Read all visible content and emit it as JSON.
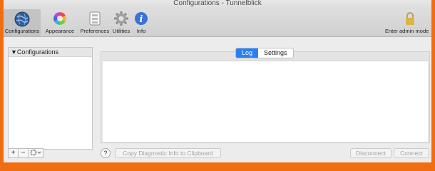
{
  "window": {
    "title": "Configurations - Tunnelblick"
  },
  "toolbar": {
    "items": [
      {
        "label": "Configurations",
        "icon": "globe-icon"
      },
      {
        "label": "Appearance",
        "icon": "color-wheel-icon"
      },
      {
        "label": "Preferences",
        "icon": "switch-icon"
      },
      {
        "label": "Utilities",
        "icon": "gear-icon"
      },
      {
        "label": "Info",
        "icon": "info-icon"
      }
    ],
    "admin": {
      "label": "Enter admin mode",
      "icon": "lock-icon"
    }
  },
  "sidebar": {
    "header": "Configurations",
    "add": "+",
    "remove": "−"
  },
  "tabs": {
    "log": "Log",
    "settings": "Settings"
  },
  "bottom": {
    "help": "?",
    "diag": "Copy Diagnostic Info to Clipboard",
    "disconnect": "Disconnect",
    "connect": "Connect"
  },
  "colors": {
    "accent": "#2a7ff5",
    "frame": "#f26d10"
  }
}
